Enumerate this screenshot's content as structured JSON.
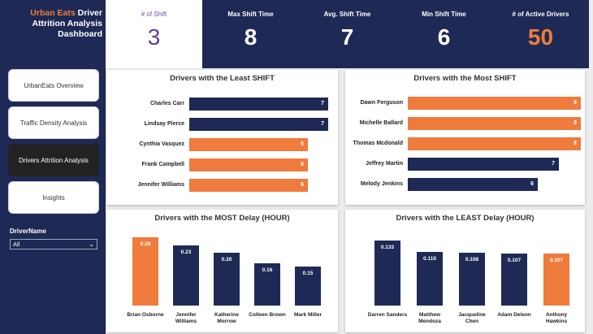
{
  "sidebar": {
    "title_brand": "Urban Eats",
    "title_rest": " Driver Attrition Analysis Dashboard",
    "nav": [
      "UrbanEats Overview",
      "Traffic Density Analysis",
      "Drivers Attrition Analysis",
      "Insights"
    ],
    "active_nav": 2,
    "slicer_label": "DriverName",
    "slicer_value": "All"
  },
  "kpis": [
    {
      "label": "# of Shift",
      "value": "3"
    },
    {
      "label": "Max Shift Time",
      "value": "8"
    },
    {
      "label": "Avg. Shift Time",
      "value": "7"
    },
    {
      "label": "Min Shift Time",
      "value": "6"
    },
    {
      "label": "# of Active Drivers",
      "value": "50"
    }
  ],
  "colors": {
    "navy": "#1e2a55",
    "orange": "#ef7b3d",
    "kpi_highlight": "#ef7b3d"
  },
  "chart_data": [
    {
      "type": "bar",
      "orientation": "horizontal",
      "title": "Drivers with the Least SHIFT",
      "categories": [
        "Charles Carr",
        "Lindsay Pierce",
        "Cynthia Vasquez",
        "Frank Campbell",
        "Jennifer Williams"
      ],
      "values": [
        7,
        7,
        6,
        6,
        6
      ],
      "colors": [
        "navy",
        "navy",
        "orange",
        "orange",
        "orange"
      ],
      "xlim": [
        0,
        7.3
      ]
    },
    {
      "type": "bar",
      "orientation": "horizontal",
      "title": "Drivers with the Most SHIFT",
      "categories": [
        "Dawn Ferguson",
        "Michelle Ballard",
        "Thomas Mcdonald",
        "Jeffrey Martin",
        "Melody Jenkins"
      ],
      "values": [
        8,
        8,
        8,
        7,
        6
      ],
      "colors": [
        "orange",
        "orange",
        "orange",
        "navy",
        "navy"
      ],
      "xlim": [
        0,
        8
      ]
    },
    {
      "type": "bar",
      "orientation": "vertical",
      "title": "Drivers with the MOST Delay (HOUR)",
      "categories": [
        "Brian Osborne",
        "Jennifer Williams",
        "Katherine Morrow",
        "Colleen Brown",
        "Mark Miller"
      ],
      "values": [
        0.26,
        0.23,
        0.2,
        0.16,
        0.15
      ],
      "labels": [
        "0.26",
        "0.23",
        "0.20",
        "0.16",
        "0.15"
      ],
      "colors": [
        "orange",
        "navy",
        "navy",
        "navy",
        "navy"
      ],
      "ylim": [
        0,
        0.26
      ]
    },
    {
      "type": "bar",
      "orientation": "vertical",
      "title": "Drivers with the LEAST Delay (HOUR)",
      "categories": [
        "Darren Sanders",
        "Matthew Mendoza",
        "Jacqueline Chen",
        "Adam Deleon",
        "Anthony Hawkins"
      ],
      "values": [
        0.133,
        0.11,
        0.108,
        0.107,
        0.107
      ],
      "labels": [
        "0.133",
        "0.110",
        "0.108",
        "0.107",
        "0.107"
      ],
      "colors": [
        "navy",
        "navy",
        "navy",
        "navy",
        "orange"
      ],
      "ylim": [
        0,
        0.133
      ]
    }
  ]
}
